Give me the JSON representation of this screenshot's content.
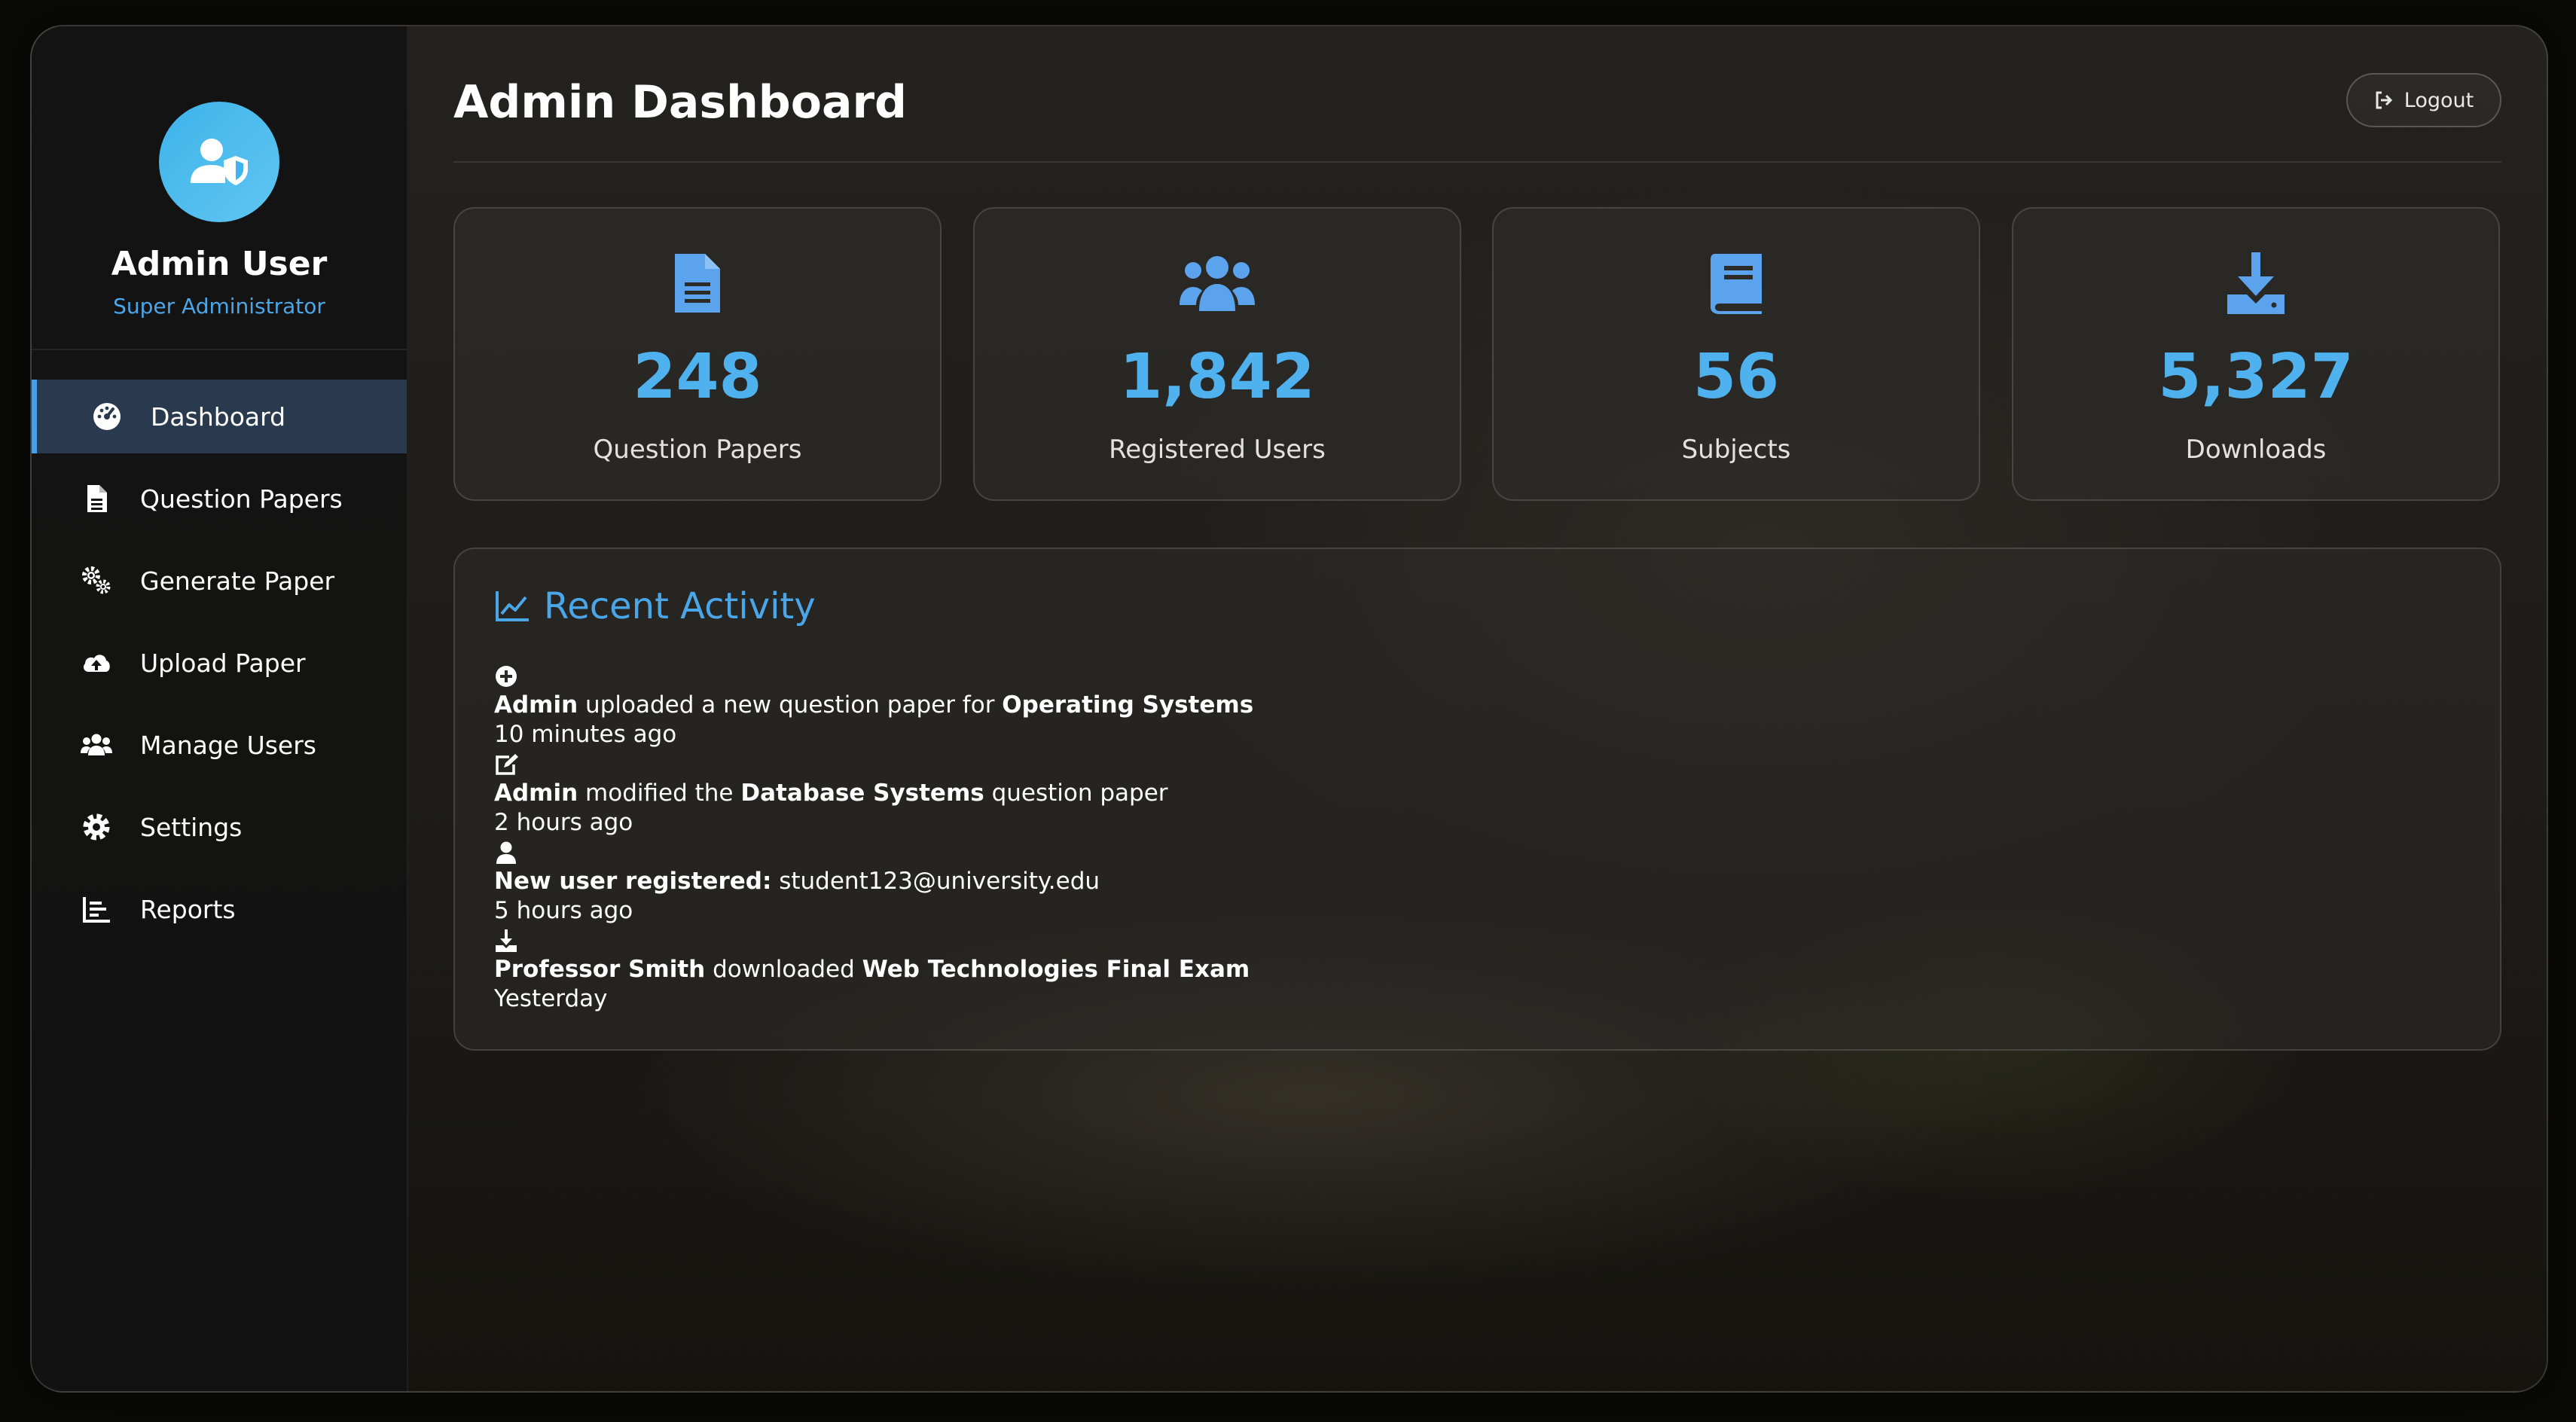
{
  "profile": {
    "name": "Admin User",
    "role": "Super Administrator"
  },
  "nav": [
    {
      "label": "Dashboard",
      "icon": "gauge-icon",
      "active": true
    },
    {
      "label": "Question Papers",
      "icon": "file-icon"
    },
    {
      "label": "Generate Paper",
      "icon": "cogs-icon"
    },
    {
      "label": "Upload Paper",
      "icon": "cloud-upload-icon"
    },
    {
      "label": "Manage Users",
      "icon": "users-icon"
    },
    {
      "label": "Settings",
      "icon": "gear-icon"
    },
    {
      "label": "Reports",
      "icon": "chart-bar-icon"
    }
  ],
  "header": {
    "title": "Admin Dashboard",
    "logout_label": "Logout"
  },
  "stats": [
    {
      "value": "248",
      "label": "Question Papers",
      "icon": "file-alt-icon"
    },
    {
      "value": "1,842",
      "label": "Registered Users",
      "icon": "users-icon"
    },
    {
      "value": "56",
      "label": "Subjects",
      "icon": "book-icon"
    },
    {
      "value": "5,327",
      "label": "Downloads",
      "icon": "download-icon"
    }
  ],
  "activity": {
    "title": "Recent Activity",
    "items": [
      {
        "icon": "plus-circle-icon",
        "parts": [
          {
            "text": "Admin",
            "bold": true
          },
          {
            "text": " uploaded a new question paper for ",
            "bold": false
          },
          {
            "text": "Operating Systems",
            "bold": true
          }
        ],
        "time": "10 minutes ago"
      },
      {
        "icon": "edit-icon",
        "parts": [
          {
            "text": "Admin",
            "bold": true
          },
          {
            "text": " modified the ",
            "bold": false
          },
          {
            "text": "Database Systems",
            "bold": true
          },
          {
            "text": " question paper",
            "bold": false
          }
        ],
        "time": "2 hours ago"
      },
      {
        "icon": "user-icon",
        "parts": [
          {
            "text": "New user registered:",
            "bold": true
          },
          {
            "text": " student123@university.edu",
            "bold": false
          }
        ],
        "time": "5 hours ago"
      },
      {
        "icon": "download-icon",
        "parts": [
          {
            "text": "Professor Smith",
            "bold": true
          },
          {
            "text": " downloaded ",
            "bold": false
          },
          {
            "text": "Web Technologies Final Exam",
            "bold": true
          }
        ],
        "time": "Yesterday"
      }
    ]
  },
  "colors": {
    "accent": "#4fb2ee",
    "link": "#4ba6e8",
    "active_nav": "#2a3a4e"
  }
}
